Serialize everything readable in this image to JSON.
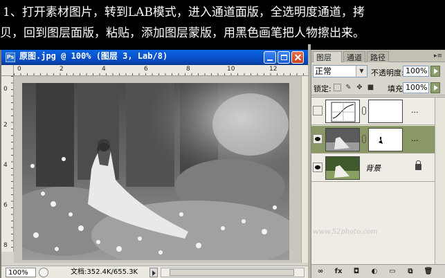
{
  "banner": {
    "line1": "1、打开素材图片，转到LAB模式，进入通道面版，全选明度通道，拷",
    "line2": "贝，回到图层面版，粘贴，添加图层蒙版，用黑色画笔把人物擦出来。"
  },
  "document": {
    "title": "原图.jpg @ 100% (图层 3, Lab/8)",
    "app_icon": "Ps",
    "ruler_top_labels": [
      "0",
      "2",
      "4",
      "6",
      "8",
      "10",
      "12"
    ],
    "ruler_left_labels": [
      "0",
      "2",
      "4",
      "6",
      "8"
    ],
    "zoom": "100%",
    "doc_info": "文档:352.4K/655.3K"
  },
  "layers_panel": {
    "tabs": [
      {
        "label": "图层",
        "close": "×"
      },
      {
        "label": "通道"
      },
      {
        "label": "路径"
      }
    ],
    "menu_icon": "▸≡",
    "blend_mode": "正常",
    "opacity_label": "不透明度:",
    "opacity_value": "100%",
    "lock_label": "锁定:",
    "fill_label": "填充:",
    "fill_value": "100%",
    "layers": [
      {
        "name": "",
        "visible": false,
        "selected": false,
        "has_mask": true,
        "dots": "..."
      },
      {
        "name": "",
        "visible": true,
        "selected": true,
        "has_mask": true,
        "dots": "..."
      },
      {
        "name": "背景",
        "visible": true,
        "selected": false,
        "locked": true
      }
    ],
    "bottom_icons": [
      "link-icon",
      "fx-icon",
      "mask-icon",
      "adjustment-icon",
      "group-icon",
      "new-layer-icon",
      "trash-icon"
    ],
    "bottom_labels": [
      "∞",
      "fx",
      "◘",
      "◐",
      "▭",
      "⧉",
      "🗑"
    ]
  },
  "watermark": "www.52photo.com"
}
